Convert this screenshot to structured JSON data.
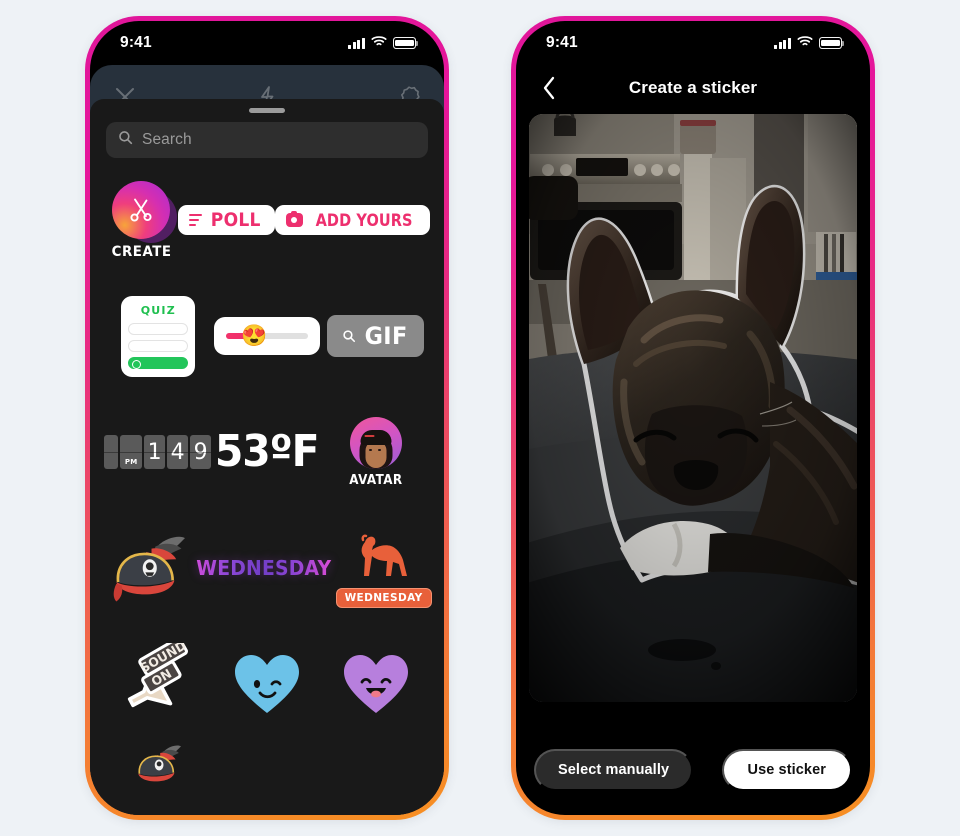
{
  "canvas": {
    "background": "#eef2f6"
  },
  "theme": {
    "frame_gradient_start": "#e0169a",
    "frame_gradient_end": "#f79022",
    "tray_bg": "#191919",
    "accent_pink": "#ed2f6e",
    "accent_green": "#22c55a"
  },
  "phones": {
    "left": {
      "name": "sticker-tray-phone",
      "status": {
        "time": "9:41",
        "signal_icon": "cellular-bars-icon",
        "wifi_icon": "wifi-icon",
        "battery_icon": "battery-icon"
      },
      "camera_toolbar": {
        "close_icon": "close-icon",
        "flash_icon": "flash-bolt-icon",
        "settings_icon": "gear-outline-icon"
      },
      "tray": {
        "grabber": "drag-handle",
        "search": {
          "placeholder": "Search",
          "icon": "search-icon"
        }
      },
      "stickers": [
        [
          {
            "id": "create",
            "type": "create-badge",
            "label": "CREATE",
            "icon": "scissors-icon"
          },
          {
            "id": "poll",
            "type": "pill",
            "label": "POLL",
            "icon": "poll-bars-icon"
          },
          {
            "id": "add-yours",
            "type": "pill",
            "label": "ADD YOURS",
            "icon": "camera-icon"
          }
        ],
        [
          {
            "id": "quiz",
            "type": "card",
            "label": "QUIZ",
            "options": 3,
            "selected_index": 2
          },
          {
            "id": "emoji-slider",
            "type": "slider",
            "emoji": "😍",
            "fill_percent": 46
          },
          {
            "id": "gif",
            "type": "button",
            "label": "GIF",
            "icon": "search-icon"
          }
        ],
        [
          {
            "id": "clock",
            "type": "flip-clock",
            "meridiem": "PM",
            "digits": [
              "1",
              "4",
              "9"
            ]
          },
          {
            "id": "temperature",
            "type": "text",
            "label": "53ºF"
          },
          {
            "id": "avatar",
            "type": "avatar",
            "label": "AVATAR"
          }
        ],
        [
          {
            "id": "pirate-hat",
            "type": "art",
            "label": ""
          },
          {
            "id": "wednesday-word",
            "type": "art-text",
            "label": "WEDNESDAY"
          },
          {
            "id": "camel-wednesday",
            "type": "art-badge",
            "label": "WEDNESDAY"
          }
        ],
        [
          {
            "id": "sound-on",
            "type": "art-text",
            "label": "SOUND ON"
          },
          {
            "id": "heart-wink",
            "type": "art",
            "label": ""
          },
          {
            "id": "heart-smile",
            "type": "art",
            "label": ""
          }
        ]
      ],
      "partial_row": [
        {
          "id": "pirate-hat-2",
          "type": "art",
          "label": ""
        }
      ]
    },
    "right": {
      "name": "create-sticker-phone",
      "status": {
        "time": "9:41",
        "signal_icon": "cellular-bars-icon",
        "wifi_icon": "wifi-icon",
        "battery_icon": "battery-icon"
      },
      "nav": {
        "back_icon": "chevron-left-icon",
        "title": "Create a sticker"
      },
      "photo": {
        "name": "dog-photo",
        "subject": "french-bulldog",
        "cutout_outline": true,
        "alt": "French bulldog lying on a dark couch in a kitchen, with a white sticker cutout outline"
      },
      "actions": {
        "secondary_label": "Select manually",
        "primary_label": "Use sticker"
      }
    }
  }
}
